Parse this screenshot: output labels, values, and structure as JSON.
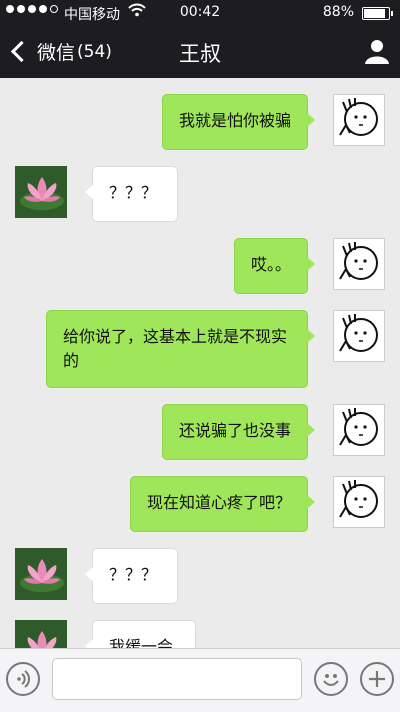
{
  "status_bar": {
    "carrier": "中国移动",
    "time": "00:42",
    "battery": "88%",
    "battery_level": 0.88,
    "signal_bars_filled": 4,
    "signal_bars_total": 5
  },
  "nav": {
    "back_label": "微信",
    "unread_count": "(54)",
    "title": "王叔"
  },
  "messages": [
    {
      "dir": "out",
      "text": "我就是怕你被骗"
    },
    {
      "dir": "in",
      "text": "？？？"
    },
    {
      "dir": "out",
      "text": "哎。。"
    },
    {
      "dir": "out",
      "text": "给你说了，这基本上就是不现实的"
    },
    {
      "dir": "out",
      "text": "还说骗了也没事"
    },
    {
      "dir": "out",
      "text": "现在知道心疼了吧？"
    },
    {
      "dir": "in",
      "text": "？？？"
    },
    {
      "dir": "in",
      "text": "我缓一会"
    }
  ],
  "input": {
    "value": "",
    "placeholder": ""
  },
  "colors": {
    "bar_bg": "#1d1d21",
    "chat_bg": "#ebebeb",
    "outgoing_bubble": "#9fe65a",
    "incoming_bubble": "#ffffff"
  },
  "icons": {
    "back": "chevron-left-icon",
    "profile": "person-icon",
    "voice": "voice-icon",
    "emoji": "emoji-icon",
    "more": "plus-icon"
  }
}
